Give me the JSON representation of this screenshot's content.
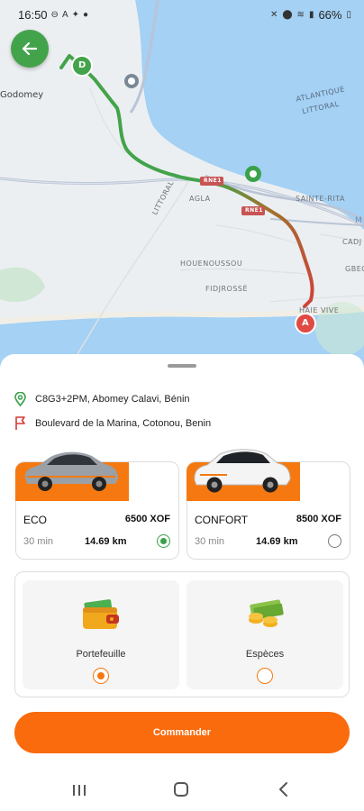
{
  "status_bar": {
    "time": "16:50",
    "battery": "66%",
    "left_icons": [
      "minus-circle-icon",
      "a-notification-icon",
      "bird-icon",
      "whatsapp-icon"
    ],
    "right_icons": [
      "mute-icon",
      "location-icon",
      "wifi-icon",
      "signal-icon",
      "battery-icon"
    ]
  },
  "map": {
    "labels": {
      "godomey": "Godomey",
      "atlantique": "ATLANTIQUE",
      "littoral_right": "LITTORAL",
      "littoral_road": "LITTORAL",
      "agla": "AGLA",
      "sainte_rita": "SAINTE-RITA",
      "houenoussou": "HOUENOUSSOU",
      "fidjrosse": "FIDJROSSÈ",
      "haie_vive": "HAIE VIVE",
      "cadj": "CADJ",
      "gbeg": "GBEG",
      "m": "M",
      "rne1_a": "RNE1",
      "rne1_b": "RNE1"
    },
    "marker_d": "D",
    "marker_a": "A",
    "route_colors": {
      "start": "#43a34b",
      "end": "#d0413a"
    },
    "water_color": "#a4d1f4"
  },
  "back_button": {
    "icon": "arrow-left-icon",
    "color": "#43a34b"
  },
  "sheet": {
    "pickup": {
      "icon": "location-pin-icon",
      "text": "C8G3+2PM, Abomey Calavi, Bénin"
    },
    "destination": {
      "icon": "flag-icon",
      "text": "Boulevard de la Marina, Cotonou, Benin"
    }
  },
  "vehicles": [
    {
      "name": "ECO",
      "price": "6500 XOF",
      "duration": "30 min",
      "distance": "14.69 km",
      "selected": true
    },
    {
      "name": "CONFORT",
      "price": "8500 XOF",
      "duration": "30 min",
      "distance": "14.69 km",
      "selected": false
    }
  ],
  "payment": {
    "options": [
      {
        "label": "Portefeuille",
        "icon": "wallet-icon",
        "selected": true
      },
      {
        "label": "Espèces",
        "icon": "cash-icon",
        "selected": false
      }
    ]
  },
  "order_button": {
    "label": "Commander",
    "color": "#f96b0d"
  },
  "accent_color": "#f57910"
}
